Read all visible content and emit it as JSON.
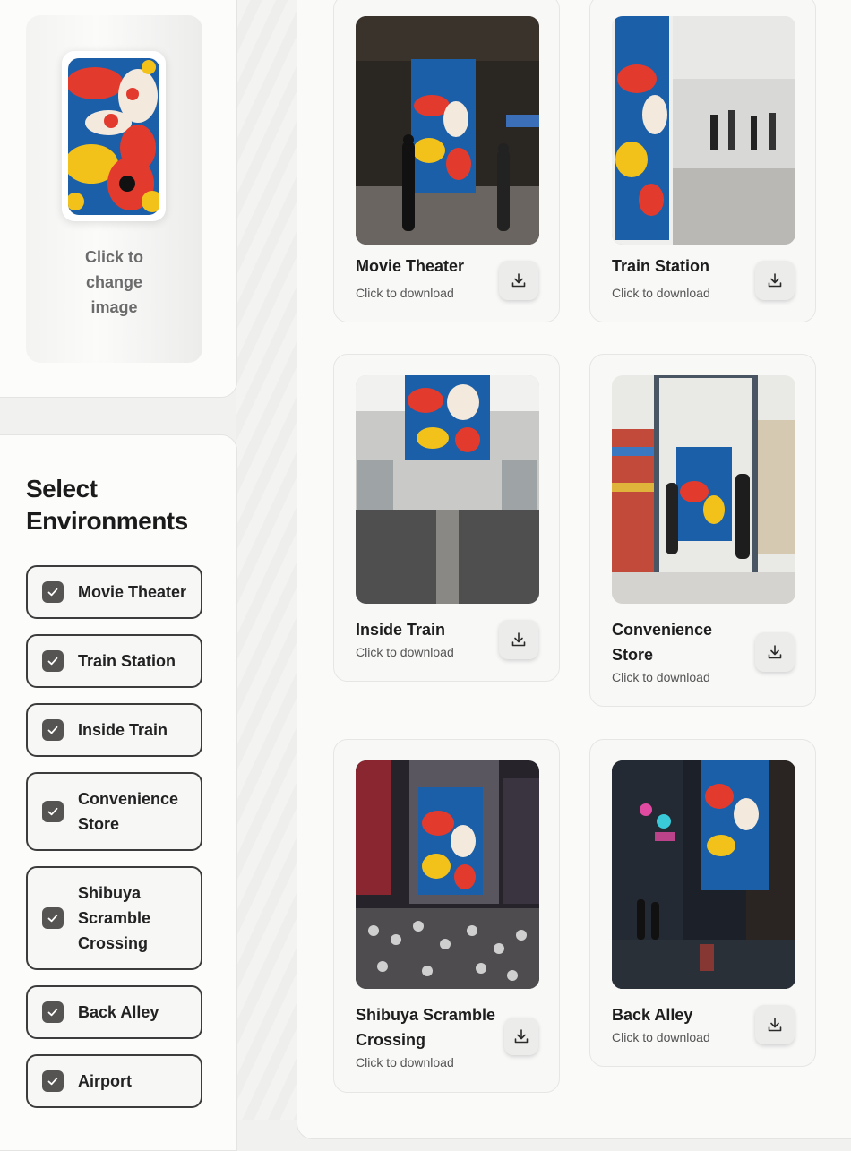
{
  "upload": {
    "label": "Click to change image"
  },
  "environments": {
    "title": "Select Environments",
    "items": [
      {
        "label": "Movie Theater",
        "checked": true
      },
      {
        "label": "Train Station",
        "checked": true
      },
      {
        "label": "Inside Train",
        "checked": true
      },
      {
        "label": "Convenience Store",
        "checked": true
      },
      {
        "label": "Shibuya Scramble Crossing",
        "checked": true
      },
      {
        "label": "Back Alley",
        "checked": true
      },
      {
        "label": "Airport",
        "checked": true
      }
    ]
  },
  "results": [
    {
      "title": "Movie Theater",
      "subtitle": "Click to download",
      "icon": "download-icon"
    },
    {
      "title": "Train Station",
      "subtitle": "Click to download",
      "icon": "download-icon"
    },
    {
      "title": "Inside Train",
      "subtitle": "Click to download",
      "icon": "download-icon"
    },
    {
      "title": "Convenience Store",
      "subtitle": "Click to download",
      "icon": "download-icon"
    },
    {
      "title": "Shibuya Scramble Crossing",
      "subtitle": "Click to download",
      "icon": "download-icon"
    },
    {
      "title": "Back Alley",
      "subtitle": "Click to download",
      "icon": "download-icon"
    }
  ],
  "colors": {
    "accent": "#555452",
    "koi_red": "#e23b2e",
    "koi_yellow": "#f2c21b",
    "poster_blue": "#1b5fa8"
  }
}
